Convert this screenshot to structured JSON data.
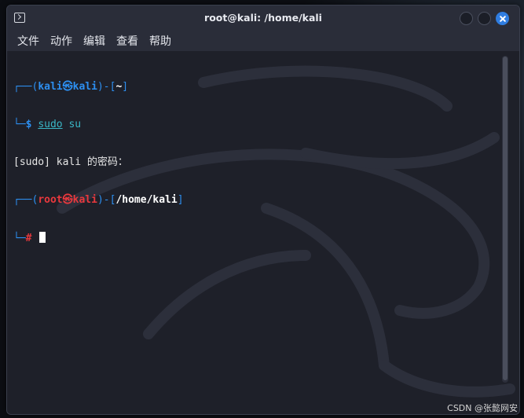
{
  "window": {
    "title": "root@kali: /home/kali",
    "icon": "terminal-icon"
  },
  "menu": {
    "items": [
      "文件",
      "动作",
      "编辑",
      "查看",
      "帮助"
    ]
  },
  "terminal": {
    "line1": {
      "corner": "┌──",
      "open": "(",
      "user": "kali",
      "at": "㉿",
      "host": "kali",
      "close": ")",
      "dash": "-",
      "lb": "[",
      "path": "~",
      "rb": "]"
    },
    "line2": {
      "corner": "└─",
      "prompt": "$",
      "space": " ",
      "cmd": "sudo",
      "arg": " su"
    },
    "line3": {
      "text": "[sudo] kali 的密码："
    },
    "line4": {
      "corner": "┌──",
      "open": "(",
      "user": "root",
      "at": "㉿",
      "host": "kali",
      "close": ")",
      "dash": "-",
      "lb": "[",
      "path": "/home/kali",
      "rb": "]"
    },
    "line5": {
      "corner": "└─",
      "prompt": "#",
      "space": " "
    }
  },
  "watermark": "CSDN @张懿网安",
  "colors": {
    "prompt_blue": "#2d8ff0",
    "root_red": "#e8383d",
    "command_cyan": "#3ab7c6",
    "close_button": "#2f7de1"
  }
}
